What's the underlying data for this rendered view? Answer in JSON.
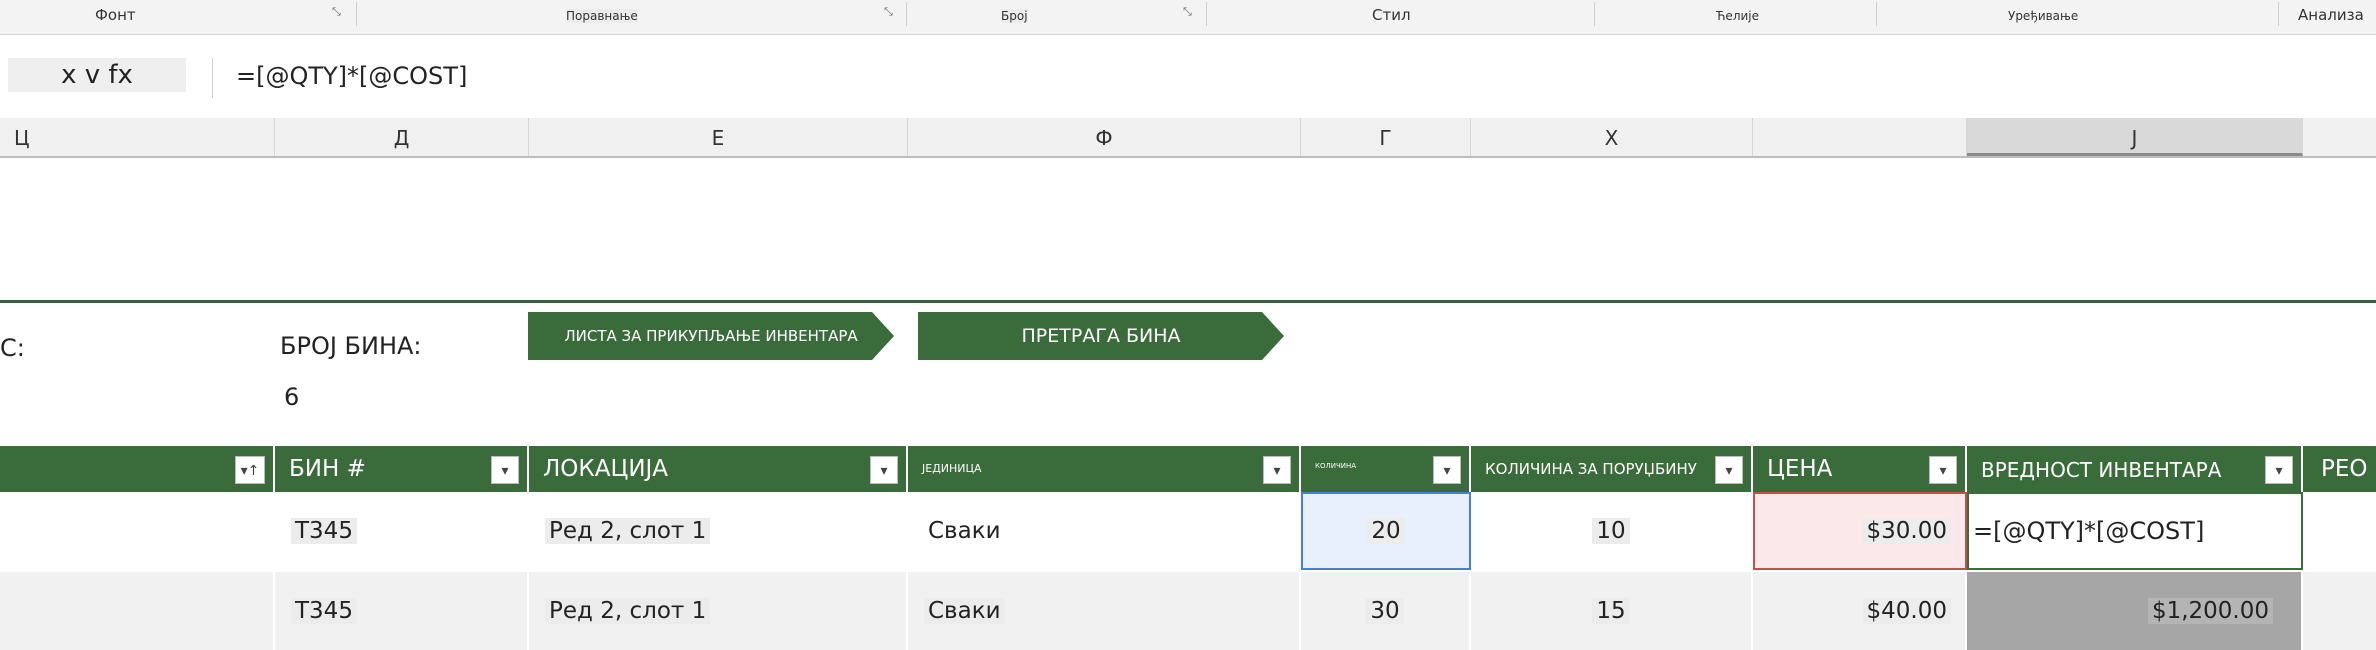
{
  "ribbon": {
    "groups": [
      "Фонт",
      "Поравнање",
      "Број",
      "Стил",
      "Ћелије",
      "Уређивање",
      "Анализа"
    ]
  },
  "formula_bar": {
    "name_box": "x v fx",
    "formula": "=[@QTY]*[@COST]"
  },
  "columns": [
    "Ц",
    "Д",
    "Е",
    "Ф",
    "Г",
    "Х",
    "",
    "J"
  ],
  "sheet": {
    "left_label": "С:",
    "bin_count_label": "БРОЈ БИНА:",
    "bin_count_value": "6",
    "btn_inventory": "ЛИСТА ЗА ПРИКУПЉАЊЕ ИНВЕНТАРА",
    "btn_search": "ПРЕТРАГА БИНА"
  },
  "table": {
    "headers": [
      "БИН #",
      "ЛОКАЦИЈА",
      "ЈЕДИНИЦА",
      "КОЛИЧИНА",
      "КОЛИЧИНА ЗА ПОРУЏБИНУ",
      "ЦЕНА",
      "ВРЕДНОСТ ИНВЕНТАРА",
      "РЕО"
    ],
    "rows": [
      {
        "bin": "Т345",
        "location": "Ред 2, слот 1",
        "unit": "Сваки",
        "qty": "20",
        "reorder": "10",
        "cost": "$30.00",
        "value": "=[@QTY]*[@COST]"
      },
      {
        "bin": "Т345",
        "location": "Ред 2, слот 1",
        "unit": "Сваки",
        "qty": "30",
        "reorder": "15",
        "cost": "$40.00",
        "value": "$1,200.00"
      }
    ]
  },
  "colors": {
    "accent": "#3a6b3a",
    "qty_selected_fill": "#e8f0fb",
    "cost_selected_fill": "#fbe9e9",
    "value_fill": "#a6a6a6"
  }
}
